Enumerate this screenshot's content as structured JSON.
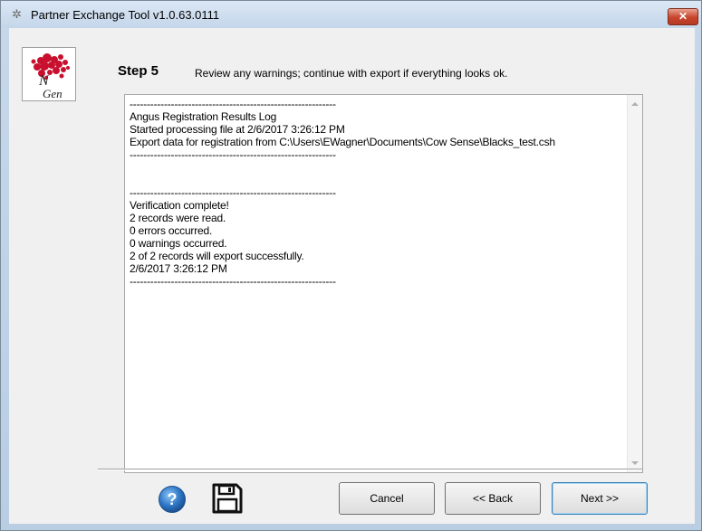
{
  "window": {
    "title": "Partner Exchange Tool v1.0.63.0111",
    "close_label": "✕"
  },
  "logo": {
    "text": "NGen"
  },
  "header": {
    "step_label": "Step 5",
    "step_description": "Review any warnings; continue with export if everything looks ok."
  },
  "log": {
    "lines": [
      "------------------------------------------------------------",
      "Angus Registration Results Log",
      "Started processing file at 2/6/2017 3:26:12 PM",
      "Export data for registration from C:\\Users\\EWagner\\Documents\\Cow Sense\\Blacks_test.csh",
      "------------------------------------------------------------",
      "",
      "",
      "------------------------------------------------------------",
      "Verification complete!",
      "2 records were read.",
      "0 errors occurred.",
      "0 warnings occurred.",
      "2 of 2 records will export successfully.",
      "2/6/2017 3:26:12 PM",
      "------------------------------------------------------------"
    ]
  },
  "footer": {
    "cancel_label": "Cancel",
    "back_label": "<< Back",
    "next_label": "Next >>"
  },
  "icons": {
    "help": "help-icon",
    "save": "floppy-disk-icon"
  },
  "colors": {
    "accent": "#3c7fb1",
    "logo_red": "#c8102e",
    "close_red": "#c8442c"
  }
}
